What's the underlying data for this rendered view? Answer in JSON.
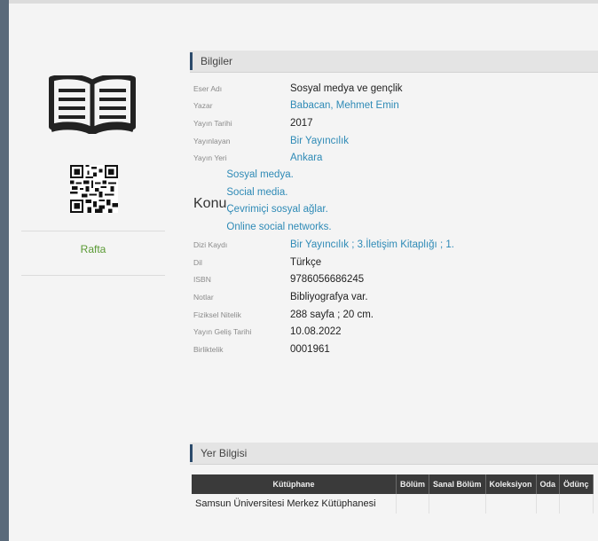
{
  "left_panel": {
    "book_icon": "open-book-icon",
    "qr_icon": "qr-code-icon",
    "shelf_status": "Rafta"
  },
  "info_section": {
    "title": "Bilgiler",
    "rows": [
      {
        "label": "Eser Adı",
        "value": "Sosyal medya ve gençlik",
        "link": false
      },
      {
        "label": "Yazar",
        "value": "Babacan, Mehmet Emin",
        "link": true
      },
      {
        "label": "Yayın Tarihi",
        "value": "2017",
        "link": false
      },
      {
        "label": "Yayınlayan",
        "value": "Bir Yayıncılık",
        "link": true
      },
      {
        "label": "Yayın Yeri",
        "value": "Ankara",
        "link": true
      }
    ],
    "subject": {
      "label": "Konu",
      "values": [
        "Sosyal medya.",
        "Social media.",
        "Çevrimiçi sosyal ağlar.",
        "Online social networks."
      ]
    },
    "rows2": [
      {
        "label": "Dizi Kaydı",
        "value": "Bir Yayıncılık ; 3.İletişim Kitaplığı ; 1.",
        "link": true
      },
      {
        "label": "Dil",
        "value": "Türkçe",
        "link": false
      },
      {
        "label": "ISBN",
        "value": "9786056686245",
        "link": false
      },
      {
        "label": "Notlar",
        "value": "Bibliyografya var.",
        "link": false
      },
      {
        "label": "Fiziksel Nitelik",
        "value": "288 sayfa ; 20 cm.",
        "link": false
      },
      {
        "label": "Yayın Geliş Tarihi",
        "value": "10.08.2022",
        "link": false
      },
      {
        "label": "Birliktelik",
        "value": "0001961",
        "link": false
      }
    ]
  },
  "location_section": {
    "title": "Yer Bilgisi",
    "columns": [
      "Kütüphane",
      "Bölüm",
      "Sanal Bölüm",
      "Koleksiyon",
      "Oda",
      "Ödünç"
    ],
    "rows": [
      [
        "Samsun Üniversitesi Merkez Kütüphanesi",
        "",
        "",
        "",
        "",
        ""
      ]
    ]
  }
}
